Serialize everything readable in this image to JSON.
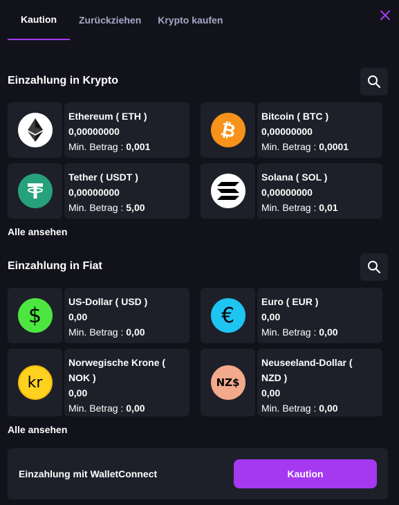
{
  "tabs": [
    {
      "label": "Kaution",
      "active": true
    },
    {
      "label": "Zurückziehen",
      "active": false
    },
    {
      "label": "Krypto kaufen",
      "active": false
    }
  ],
  "crypto": {
    "title": "Einzahlung in Krypto",
    "see_all": "Alle ansehen",
    "items": [
      {
        "name": "Ethereum ( ETH )",
        "balance": "0,00000000",
        "min_label": "Min. Betrag :",
        "min_value": "0,001",
        "icon": "ethereum-icon",
        "color": "#ffffff"
      },
      {
        "name": "Bitcoin ( BTC )",
        "balance": "0,00000000",
        "min_label": "Min. Betrag :",
        "min_value": "0,0001",
        "icon": "bitcoin-icon",
        "color": "#f7931a"
      },
      {
        "name": "Tether ( USDT )",
        "balance": "0,00000000",
        "min_label": "Min. Betrag :",
        "min_value": "5,00",
        "icon": "tether-icon",
        "color": "#26a17b"
      },
      {
        "name": "Solana ( SOL )",
        "balance": "0,00000000",
        "min_label": "Min. Betrag :",
        "min_value": "0,01",
        "icon": "solana-icon",
        "color": "#ffffff"
      }
    ]
  },
  "fiat": {
    "title": "Einzahlung in Fiat",
    "see_all": "Alle ansehen",
    "items": [
      {
        "name": "US-Dollar ( USD )",
        "balance": "0,00",
        "min_label": "Min. Betrag :",
        "min_value": "0,00",
        "icon": "usd-icon",
        "symbol": "$",
        "color": "#4de640"
      },
      {
        "name": "Euro ( EUR )",
        "balance": "0,00",
        "min_label": "Min. Betrag :",
        "min_value": "0,00",
        "icon": "eur-icon",
        "symbol": "€",
        "color": "#1ec4f2"
      },
      {
        "name_line1": "Norwegische Krone (",
        "name_line2": "NOK )",
        "balance": "0,00",
        "min_label": "Min. Betrag :",
        "min_value": "0,00",
        "icon": "nok-icon",
        "symbol": "kr",
        "color": "#ffd21f"
      },
      {
        "name_line1": "Neuseeland-Dollar (",
        "name_line2": "NZD )",
        "balance": "0,00",
        "min_label": "Min. Betrag :",
        "min_value": "0,00",
        "icon": "nzd-icon",
        "symbol": "NZ$",
        "color": "#f3a98c"
      }
    ]
  },
  "walletconnect": {
    "label": "Einzahlung mit WalletConnect",
    "button": "Kaution"
  },
  "colors": {
    "accent": "#a439f0",
    "background": "#12131a",
    "card": "#1e2029"
  }
}
